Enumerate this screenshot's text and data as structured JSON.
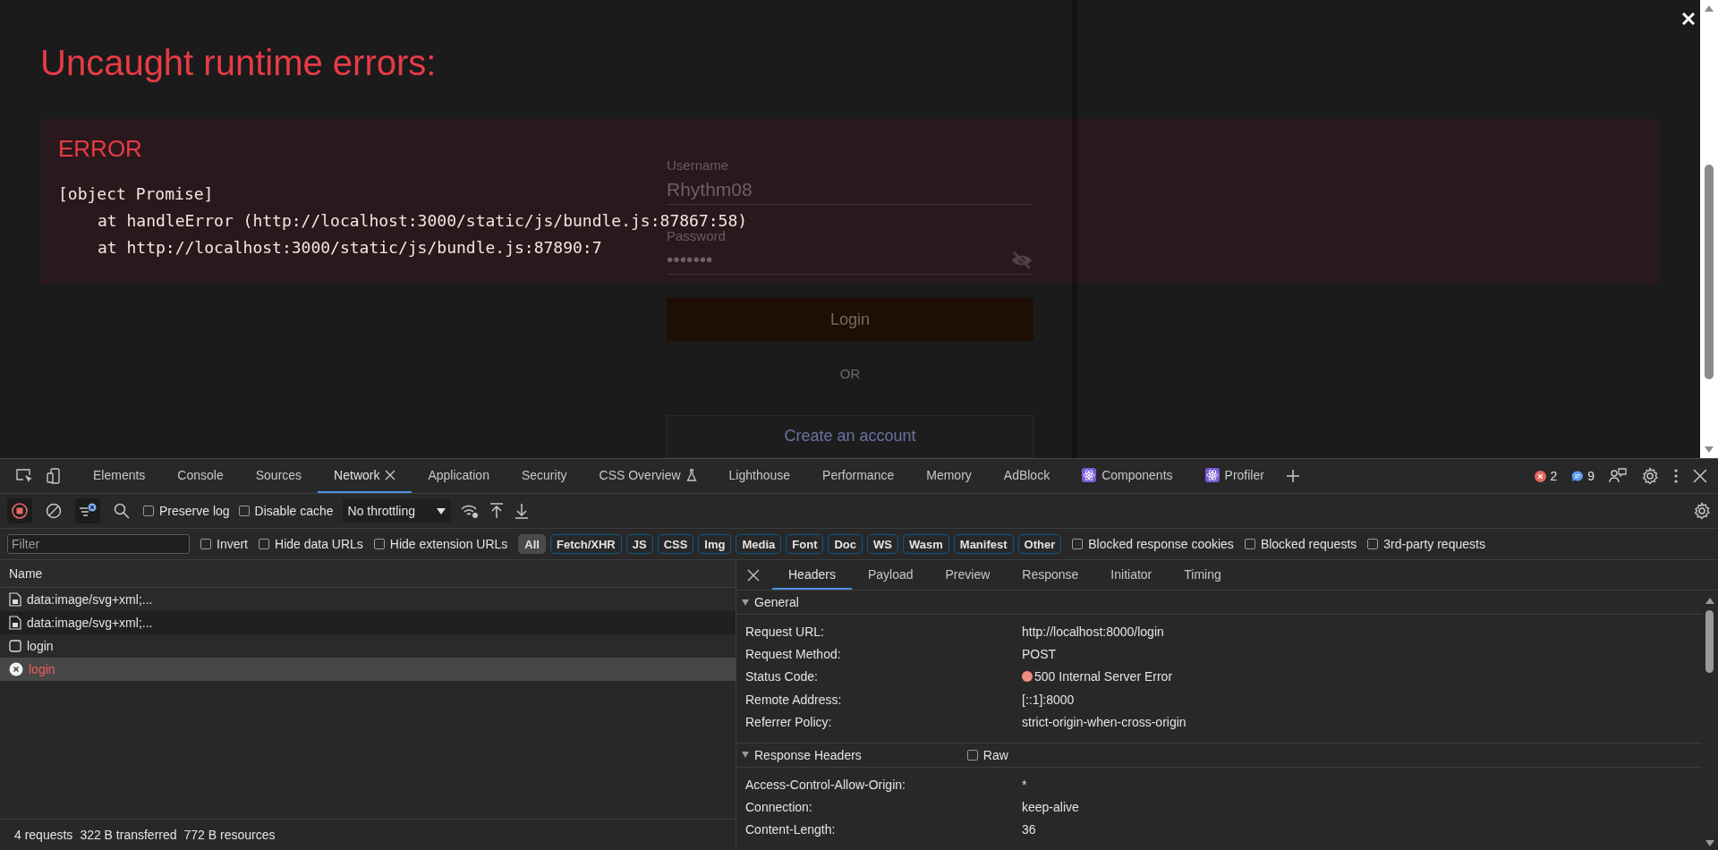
{
  "page_form": {
    "username_label": "Username",
    "username_value": "Rhythm08",
    "password_label": "Password",
    "password_value": "•••••••",
    "login_button": "Login",
    "or_text": "OR",
    "create_account_button": "Create an account"
  },
  "error_overlay": {
    "title": "Uncaught runtime errors:",
    "error_heading": "ERROR",
    "stack": [
      {
        "kind": "message",
        "text": "[object Promise]"
      },
      {
        "kind": "frame",
        "text": "at handleError (http://localhost:3000/static/js/bundle.js:87867:58)"
      },
      {
        "kind": "frame",
        "text": "at http://localhost:3000/static/js/bundle.js:87890:7"
      }
    ]
  },
  "devtools": {
    "tabs": [
      {
        "label": "Elements",
        "kind": "plain",
        "selected": false
      },
      {
        "label": "Console",
        "kind": "plain",
        "selected": false
      },
      {
        "label": "Sources",
        "kind": "plain",
        "selected": false
      },
      {
        "label": "Network",
        "kind": "closable",
        "selected": true
      },
      {
        "label": "Application",
        "kind": "plain",
        "selected": false
      },
      {
        "label": "Security",
        "kind": "plain",
        "selected": false
      },
      {
        "label": "CSS Overview",
        "kind": "experiment",
        "selected": false
      },
      {
        "label": "Lighthouse",
        "kind": "plain",
        "selected": false
      },
      {
        "label": "Performance",
        "kind": "plain",
        "selected": false
      },
      {
        "label": "Memory",
        "kind": "plain",
        "selected": false
      },
      {
        "label": "AdBlock",
        "kind": "plain",
        "selected": false
      },
      {
        "label": "Components",
        "kind": "extension",
        "selected": false
      },
      {
        "label": "Profiler",
        "kind": "extension",
        "selected": false
      }
    ],
    "error_count": "2",
    "message_count": "9",
    "toolbar": {
      "recording": true,
      "preserve_log": {
        "label": "Preserve log",
        "checked": false
      },
      "disable_cache": {
        "label": "Disable cache",
        "checked": false
      },
      "throttling": "No throttling"
    },
    "filter_bar": {
      "placeholder": "Filter",
      "invert": {
        "label": "Invert",
        "checked": false
      },
      "hide_data_urls": {
        "label": "Hide data URLs",
        "checked": false
      },
      "hide_extension_urls": {
        "label": "Hide extension URLs",
        "checked": false
      },
      "types": [
        {
          "label": "All",
          "selected": true
        },
        {
          "label": "Fetch/XHR",
          "selected": false
        },
        {
          "label": "JS",
          "selected": false
        },
        {
          "label": "CSS",
          "selected": false
        },
        {
          "label": "Img",
          "selected": false
        },
        {
          "label": "Media",
          "selected": false
        },
        {
          "label": "Font",
          "selected": false
        },
        {
          "label": "Doc",
          "selected": false
        },
        {
          "label": "WS",
          "selected": false
        },
        {
          "label": "Wasm",
          "selected": false
        },
        {
          "label": "Manifest",
          "selected": false
        },
        {
          "label": "Other",
          "selected": false
        }
      ],
      "options": [
        {
          "label": "Blocked response cookies",
          "checked": false
        },
        {
          "label": "Blocked requests",
          "checked": false
        },
        {
          "label": "3rd-party requests",
          "checked": false
        }
      ]
    },
    "requests": {
      "column": "Name",
      "rows": [
        {
          "name": "data:image/svg+xml;...",
          "kind": "image",
          "failed": false,
          "selected": false
        },
        {
          "name": "data:image/svg+xml;...",
          "kind": "image",
          "failed": false,
          "selected": false
        },
        {
          "name": "login",
          "kind": "fetch",
          "failed": false,
          "selected": false
        },
        {
          "name": "login",
          "failed": true,
          "selected": true
        }
      ]
    },
    "status_bar": [
      "4 requests",
      "322 B transferred",
      "772 B resources"
    ],
    "details": {
      "tabs": [
        {
          "label": "Headers",
          "selected": true
        },
        {
          "label": "Payload",
          "selected": false
        },
        {
          "label": "Preview",
          "selected": false
        },
        {
          "label": "Response",
          "selected": false
        },
        {
          "label": "Initiator",
          "selected": false
        },
        {
          "label": "Timing",
          "selected": false
        }
      ],
      "general": {
        "title": "General",
        "expanded": true,
        "rows": [
          {
            "label": "Request URL:",
            "value": "http://localhost:8000/login",
            "kind": "plain"
          },
          {
            "label": "Request Method:",
            "value": "POST",
            "kind": "plain"
          },
          {
            "label": "Status Code:",
            "value": "500 Internal Server Error",
            "kind": "status"
          },
          {
            "label": "Remote Address:",
            "value": "[::1]:8000",
            "kind": "plain"
          },
          {
            "label": "Referrer Policy:",
            "value": "strict-origin-when-cross-origin",
            "kind": "plain"
          }
        ]
      },
      "response_headers": {
        "title": "Response Headers",
        "expanded": true,
        "raw": {
          "label": "Raw",
          "checked": false
        },
        "rows": [
          {
            "label": "Access-Control-Allow-Origin:",
            "value": "*",
            "kind": "plain"
          },
          {
            "label": "Connection:",
            "value": "keep-alive",
            "kind": "plain"
          },
          {
            "label": "Content-Length:",
            "value": "36",
            "kind": "plain"
          }
        ]
      }
    }
  }
}
